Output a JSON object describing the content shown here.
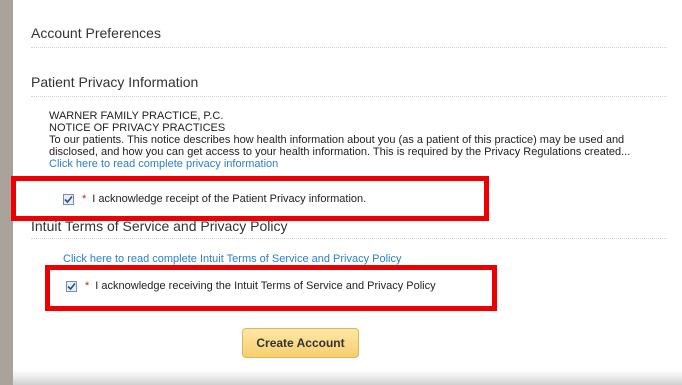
{
  "account_preferences": {
    "title": "Account Preferences"
  },
  "privacy": {
    "title": "Patient Privacy Information",
    "practice_name": "WARNER FAMILY PRACTICE, P.C.",
    "notice_title": "NOTICE OF PRIVACY PRACTICES",
    "body": "To our patients. This notice describes how health information about you (as a patient of this practice) may be used and disclosed, and how you can get access to your health information. This is required by the Privacy Regulations created...",
    "link_text": "Click here to read complete privacy information",
    "ack": {
      "checked": true,
      "required_mark": "*",
      "label": "I acknowledge receipt of the Patient Privacy information."
    }
  },
  "intuit": {
    "title": "Intuit Terms of Service and Privacy Policy",
    "link_text": "Click here to read complete Intuit Terms of Service and Privacy Policy",
    "ack": {
      "checked": true,
      "required_mark": "*",
      "label": "I acknowledge receiving the Intuit Terms of Service and Privacy Policy"
    }
  },
  "create_button": {
    "label": "Create Account"
  },
  "colors": {
    "highlight": "#ee0000",
    "link": "#2a7fc7",
    "required": "#d11a1a",
    "button": "#f6cf6f"
  }
}
